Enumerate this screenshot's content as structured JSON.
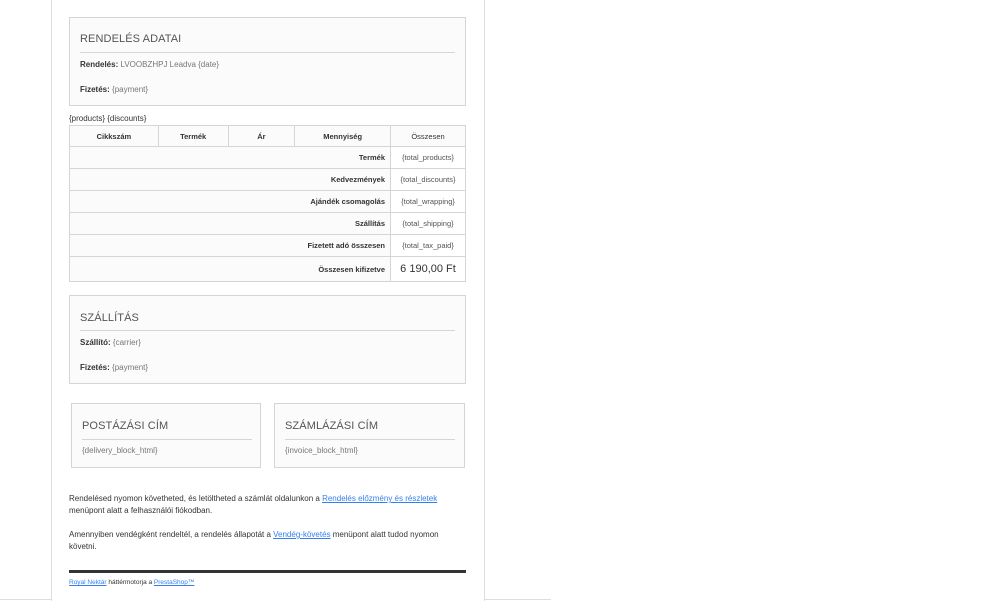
{
  "order_box": {
    "title": "RENDELÉS ADATAI",
    "order_label": "Rendelés:",
    "order_value": "LVOOBZHPJ Leadva {date}",
    "payment_label": "Fizetés:",
    "payment_value": "{payment}"
  },
  "products_placeholder": "{products} {discounts}",
  "table": {
    "headers": [
      "Cikkszám",
      "Termék",
      "Ár",
      "Mennyiség",
      "Összesen"
    ],
    "rows": [
      {
        "label": "Termék",
        "value": "{total_products}"
      },
      {
        "label": "Kedvezmények",
        "value": "{total_discounts}"
      },
      {
        "label": "Ajándék csomagolás",
        "value": "{total_wrapping}"
      },
      {
        "label": "Szállítás",
        "value": "{total_shipping}"
      },
      {
        "label": "Fizetett adó összesen",
        "value": "{total_tax_paid}"
      },
      {
        "label": "Összesen kifizetve",
        "value": "6 190,00 Ft"
      }
    ]
  },
  "shipping_box": {
    "title": "SZÁLLÍTÁS",
    "carrier_label": "Szállító:",
    "carrier_value": "{carrier}",
    "payment_label": "Fizetés:",
    "payment_value": "{payment}"
  },
  "delivery_box": {
    "title": "POSTÁZÁSI CÍM",
    "value": "{delivery_block_html}"
  },
  "invoice_box": {
    "title": "SZÁMLÁZÁSI CÍM",
    "value": "{invoice_block_html}"
  },
  "paragraph1": {
    "before": "Rendelésed nyomon követheted, és letöltheted a számlát oldalunkon a ",
    "link": "Rendelés előzmény és részletek",
    "after": " menüpont alatt a felhasználói fiókodban."
  },
  "paragraph2": {
    "before": "Amennyiben vendégként rendeltél, a rendelés állapotát a ",
    "link": "Vendég-követés",
    "after": " menüpont alatt tudod nyomon követni."
  },
  "footer": {
    "shop_link": "Royal Nektár",
    "middle": " háttérmotorja a ",
    "prestashop_link": "PrestaShop™"
  }
}
